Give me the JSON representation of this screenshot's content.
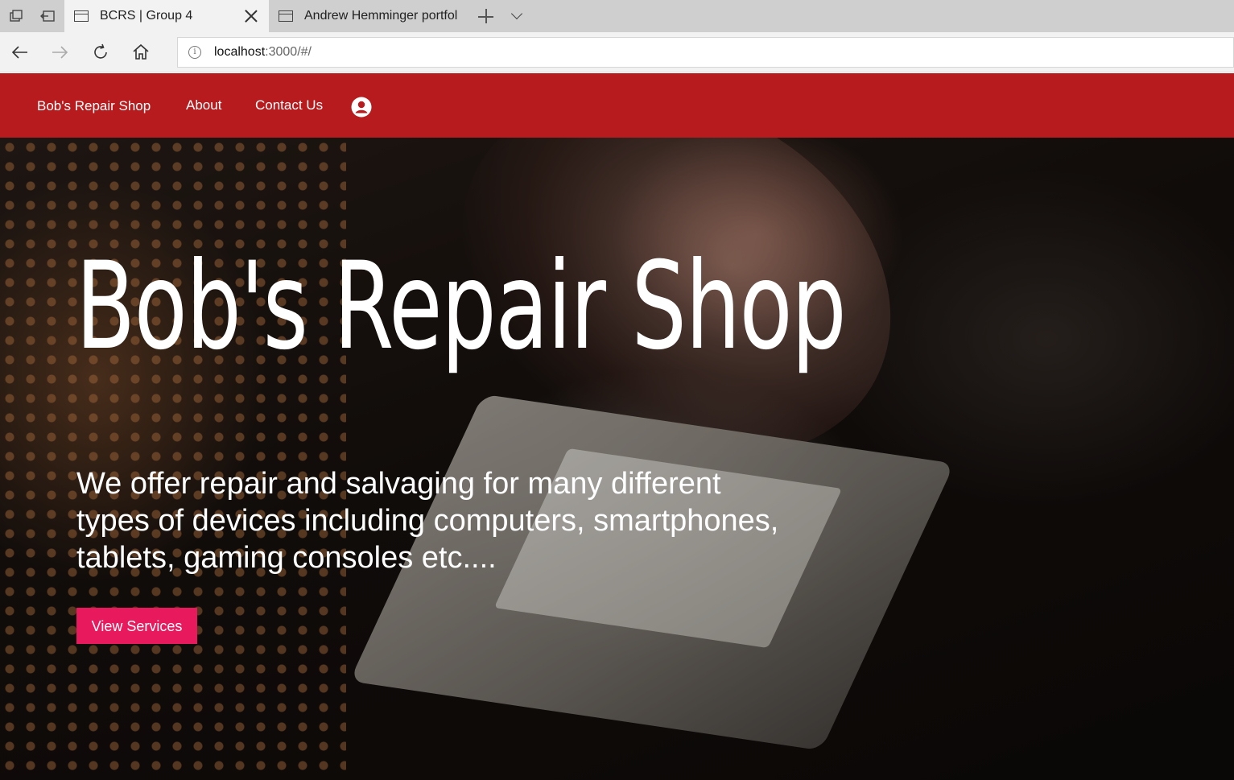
{
  "browser": {
    "tabs": [
      {
        "label": "BCRS | Group 4",
        "active": true
      },
      {
        "label": "Andrew Hemminger portfol",
        "active": false
      }
    ],
    "address": {
      "host": "localhost",
      "rest": ":3000/#/"
    }
  },
  "nav": {
    "brand": "Bob's Repair Shop",
    "about": "About",
    "contact": "Contact Us",
    "account_icon": "account-circle-icon"
  },
  "hero": {
    "title": "Bob's Repair Shop",
    "text": "We offer repair and salvaging for many different types of devices including computers, smartphones, tablets, gaming consoles etc....",
    "button": "View Services"
  },
  "colors": {
    "nav_bg": "#b71b1e",
    "button_bg": "#e8195c"
  }
}
